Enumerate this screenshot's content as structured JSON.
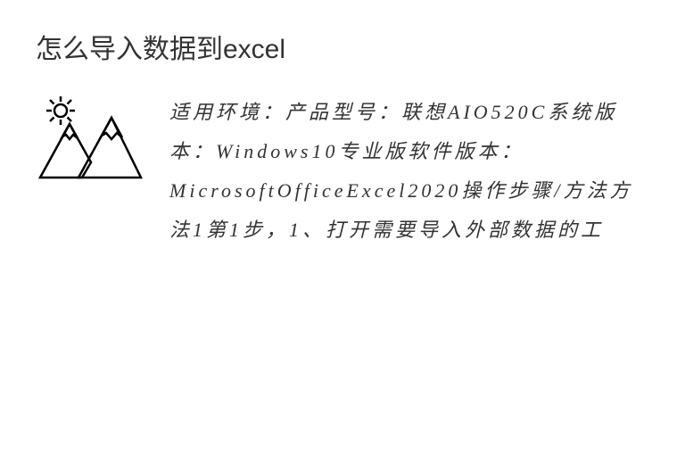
{
  "article": {
    "title": "怎么导入数据到excel",
    "body": "适用环境：产品型号：联想AIO520C系统版本：Windows10专业版软件版本：MicrosoftOfficeExcel2020操作步骤/方法方法1第1步，1、打开需要导入外部数据的工"
  }
}
